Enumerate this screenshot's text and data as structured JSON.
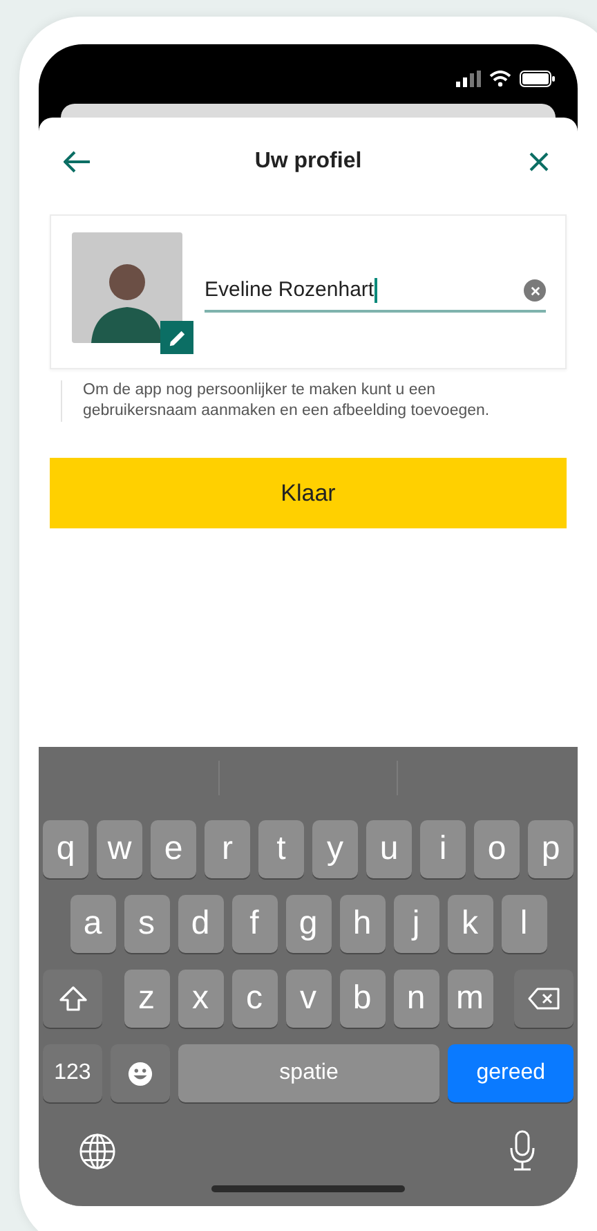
{
  "header": {
    "title": "Uw profiel"
  },
  "profile": {
    "name_value": "Eveline Rozenhart",
    "hint": "Om de app nog persoonlijker te maken kunt u een gebruikersnaam aanmaken en een afbeelding toevoegen."
  },
  "button": {
    "label": "Klaar"
  },
  "keyboard": {
    "letter_rows": [
      [
        {
          "kind": "char",
          "label": "q"
        },
        {
          "kind": "char",
          "label": "w"
        },
        {
          "kind": "char",
          "label": "e"
        },
        {
          "kind": "char",
          "label": "r"
        },
        {
          "kind": "char",
          "label": "t"
        },
        {
          "kind": "char",
          "label": "y"
        },
        {
          "kind": "char",
          "label": "u"
        },
        {
          "kind": "char",
          "label": "i"
        },
        {
          "kind": "char",
          "label": "o"
        },
        {
          "kind": "char",
          "label": "p"
        }
      ],
      [
        {
          "kind": "char",
          "label": "a"
        },
        {
          "kind": "char",
          "label": "s"
        },
        {
          "kind": "char",
          "label": "d"
        },
        {
          "kind": "char",
          "label": "f"
        },
        {
          "kind": "char",
          "label": "g"
        },
        {
          "kind": "char",
          "label": "h"
        },
        {
          "kind": "char",
          "label": "j"
        },
        {
          "kind": "char",
          "label": "k"
        },
        {
          "kind": "char",
          "label": "l"
        }
      ],
      [
        {
          "kind": "shift"
        },
        {
          "kind": "char",
          "label": "z"
        },
        {
          "kind": "char",
          "label": "x"
        },
        {
          "kind": "char",
          "label": "c"
        },
        {
          "kind": "char",
          "label": "v"
        },
        {
          "kind": "char",
          "label": "b"
        },
        {
          "kind": "char",
          "label": "n"
        },
        {
          "kind": "char",
          "label": "m"
        },
        {
          "kind": "backspace"
        }
      ]
    ],
    "bottom_row": [
      {
        "kind": "mode",
        "label": "123"
      },
      {
        "kind": "emoji"
      },
      {
        "kind": "space",
        "label": "spatie"
      },
      {
        "kind": "return",
        "label": "gereed"
      }
    ]
  }
}
